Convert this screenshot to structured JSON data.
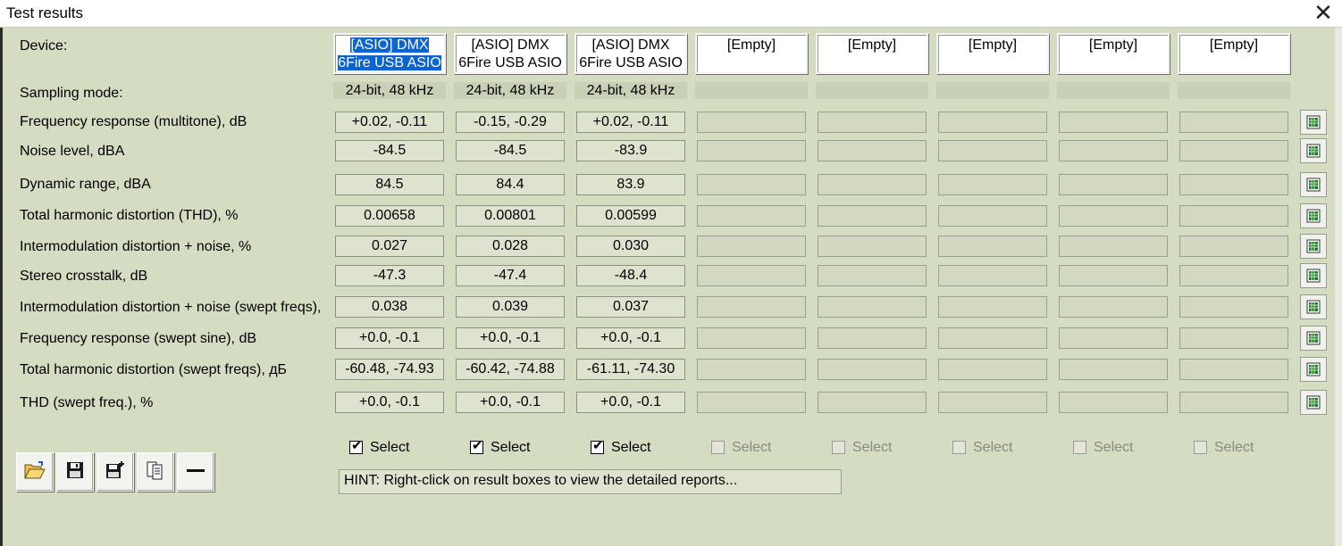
{
  "window": {
    "title": "Test results",
    "close_label": "✕"
  },
  "labels": {
    "device": "Device:",
    "sampling_mode": "Sampling mode:"
  },
  "devices": [
    {
      "line1": "[ASIO] DMX",
      "line2": "6Fire USB ASIO",
      "mode": "24-bit, 48 kHz",
      "selected": true
    },
    {
      "line1": "[ASIO] DMX",
      "line2": "6Fire USB ASIO",
      "mode": "24-bit, 48 kHz",
      "selected": false
    },
    {
      "line1": "[ASIO] DMX",
      "line2": "6Fire USB ASIO",
      "mode": "24-bit, 48 kHz",
      "selected": false
    },
    {
      "line1": "[Empty]",
      "line2": "",
      "mode": "",
      "selected": false
    },
    {
      "line1": "[Empty]",
      "line2": "",
      "mode": "",
      "selected": false
    },
    {
      "line1": "[Empty]",
      "line2": "",
      "mode": "",
      "selected": false
    },
    {
      "line1": "[Empty]",
      "line2": "",
      "mode": "",
      "selected": false
    },
    {
      "line1": "[Empty]",
      "line2": "",
      "mode": "",
      "selected": false
    }
  ],
  "metrics": [
    {
      "label": "Frequency response (multitone), dB",
      "values": [
        "+0.02, -0.11",
        "-0.15, -0.29",
        "+0.02, -0.11",
        "",
        "",
        "",
        "",
        ""
      ]
    },
    {
      "label": "Noise level, dBA",
      "values": [
        "-84.5",
        "-84.5",
        "-83.9",
        "",
        "",
        "",
        "",
        ""
      ]
    },
    {
      "label": "Dynamic range, dBA",
      "values": [
        "84.5",
        "84.4",
        "83.9",
        "",
        "",
        "",
        "",
        ""
      ]
    },
    {
      "label": "Total harmonic distortion (THD), %",
      "values": [
        "0.00658",
        "0.00801",
        "0.00599",
        "",
        "",
        "",
        "",
        ""
      ]
    },
    {
      "label": "Intermodulation distortion + noise, %",
      "values": [
        "0.027",
        "0.028",
        "0.030",
        "",
        "",
        "",
        "",
        ""
      ]
    },
    {
      "label": "Stereo crosstalk, dB",
      "values": [
        "-47.3",
        "-47.4",
        "-48.4",
        "",
        "",
        "",
        "",
        ""
      ]
    },
    {
      "label": "Intermodulation distortion + noise (swept freqs),",
      "values": [
        "0.038",
        "0.039",
        "0.037",
        "",
        "",
        "",
        "",
        ""
      ]
    },
    {
      "label": "Frequency response (swept sine), dB",
      "values": [
        "+0.0, -0.1",
        "+0.0, -0.1",
        "+0.0, -0.1",
        "",
        "",
        "",
        "",
        ""
      ]
    },
    {
      "label": "Total harmonic distortion (swept freqs), дБ",
      "values": [
        "-60.48, -74.93",
        "-60.42, -74.88",
        "-61.11, -74.30",
        "",
        "",
        "",
        "",
        ""
      ]
    },
    {
      "label": "THD (swept freq.), %",
      "values": [
        "+0.0, -0.1",
        "+0.0, -0.1",
        "+0.0, -0.1",
        "",
        "",
        "",
        "",
        ""
      ]
    }
  ],
  "select_label": "Select",
  "selects": [
    {
      "checked": true,
      "enabled": true
    },
    {
      "checked": true,
      "enabled": true
    },
    {
      "checked": true,
      "enabled": true
    },
    {
      "checked": false,
      "enabled": false
    },
    {
      "checked": false,
      "enabled": false
    },
    {
      "checked": false,
      "enabled": false
    },
    {
      "checked": false,
      "enabled": false
    },
    {
      "checked": false,
      "enabled": false
    }
  ],
  "toolbar": [
    {
      "name": "open-button",
      "icon": "folder-open-icon"
    },
    {
      "name": "save-button",
      "icon": "floppy-disk-icon"
    },
    {
      "name": "save-as-button",
      "icon": "floppy-disk-plus-icon"
    },
    {
      "name": "copy-button",
      "icon": "copy-pages-icon"
    },
    {
      "name": "remove-button",
      "icon": "minus-icon"
    }
  ],
  "hint": "HINT: Right-click on result boxes to view the detailed reports...",
  "colors": {
    "window_bg": "#d4dcc2",
    "selection": "#0a64d4",
    "cell_bg": "#dde3cf"
  }
}
